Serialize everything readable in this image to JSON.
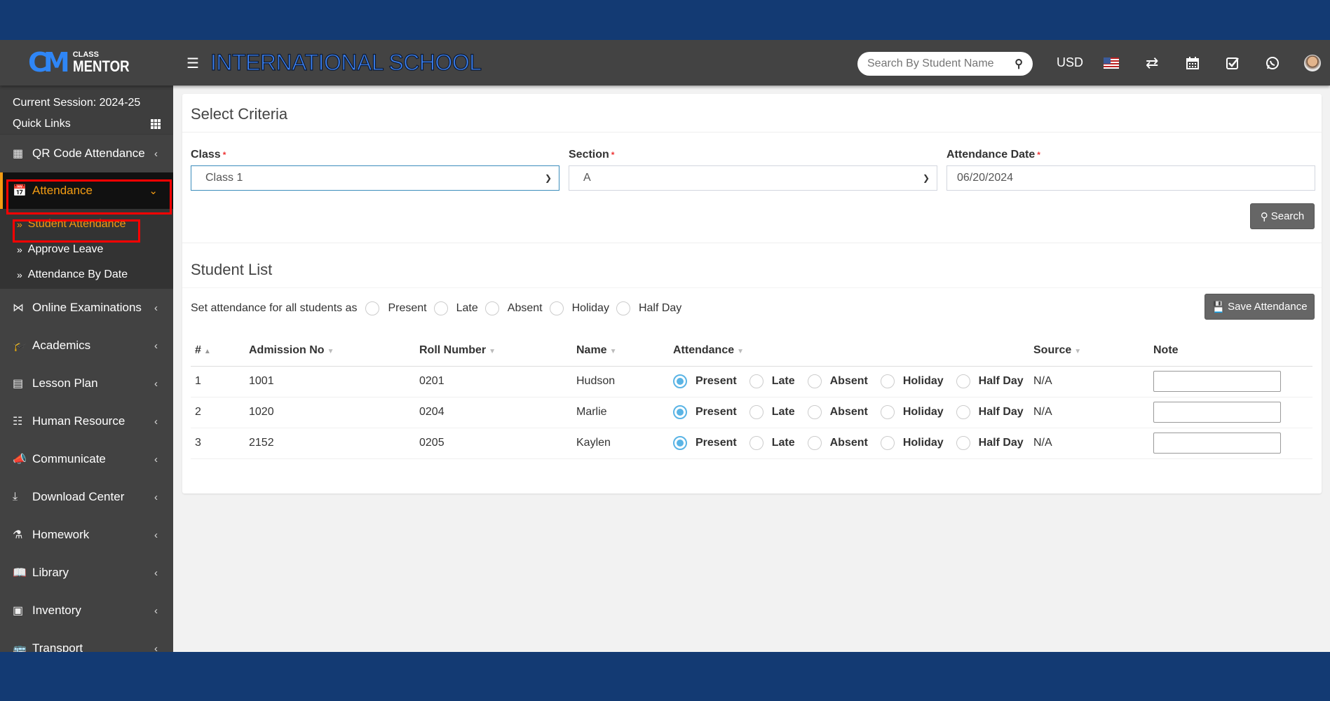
{
  "header": {
    "logo_mark": "CM",
    "logo_small": "CLASS",
    "logo_big": "MENTOR",
    "school_name": "INTERNATIONAL SCHOOL",
    "search_placeholder": "Search By Student Name",
    "currency": "USD",
    "icons": [
      "menu-icon",
      "search-icon",
      "us-flag-icon",
      "transfer-icon",
      "calendar-icon",
      "task-check-icon",
      "whatsapp-icon",
      "user-avatar"
    ]
  },
  "sidebar": {
    "session": "Current Session: 2024-25",
    "quick_links": "Quick Links",
    "items": [
      {
        "label": "QR Code Attendance",
        "icon": "qrcode-icon"
      },
      {
        "label": "Attendance",
        "icon": "calendar-check-icon",
        "active": true
      },
      {
        "label": "Online Examinations",
        "icon": "rss-icon"
      },
      {
        "label": "Academics",
        "icon": "graduation-cap-icon"
      },
      {
        "label": "Lesson Plan",
        "icon": "list-alt-icon"
      },
      {
        "label": "Human Resource",
        "icon": "sitemap-icon"
      },
      {
        "label": "Communicate",
        "icon": "bullhorn-icon"
      },
      {
        "label": "Download Center",
        "icon": "download-icon"
      },
      {
        "label": "Homework",
        "icon": "flask-icon"
      },
      {
        "label": "Library",
        "icon": "book-icon"
      },
      {
        "label": "Inventory",
        "icon": "object-group-icon"
      },
      {
        "label": "Transport",
        "icon": "bus-icon"
      }
    ],
    "attendance_sub": [
      {
        "label": "Student Attendance",
        "active": true
      },
      {
        "label": "Approve Leave"
      },
      {
        "label": "Attendance By Date"
      }
    ]
  },
  "criteria": {
    "title": "Select Criteria",
    "class_label": "Class",
    "class_value": "Class 1",
    "section_label": "Section",
    "section_value": "A",
    "date_label": "Attendance Date",
    "date_value": "06/20/2024",
    "required_mark": "*",
    "search_button": "Search"
  },
  "student_list": {
    "title": "Student List",
    "set_all_label": "Set attendance for all students as",
    "options": [
      "Present",
      "Late",
      "Absent",
      "Holiday",
      "Half Day"
    ],
    "save_button": "Save Attendance",
    "columns": [
      "#",
      "Admission No",
      "Roll Number",
      "Name",
      "Attendance",
      "Source",
      "Note"
    ],
    "rows": [
      {
        "num": "1",
        "admission": "1001",
        "roll": "0201",
        "name": "Hudson",
        "attendance": "Present",
        "source": "N/A",
        "note": ""
      },
      {
        "num": "2",
        "admission": "1020",
        "roll": "0204",
        "name": "Marlie",
        "attendance": "Present",
        "source": "N/A",
        "note": ""
      },
      {
        "num": "3",
        "admission": "2152",
        "roll": "0205",
        "name": "Kaylen",
        "attendance": "Present",
        "source": "N/A",
        "note": ""
      }
    ]
  },
  "colors": {
    "brand_blue": "#133a73",
    "accent_orange": "#f39c12",
    "radio_selected": "#5ab4e5",
    "highlight_red": "#ff0000"
  }
}
